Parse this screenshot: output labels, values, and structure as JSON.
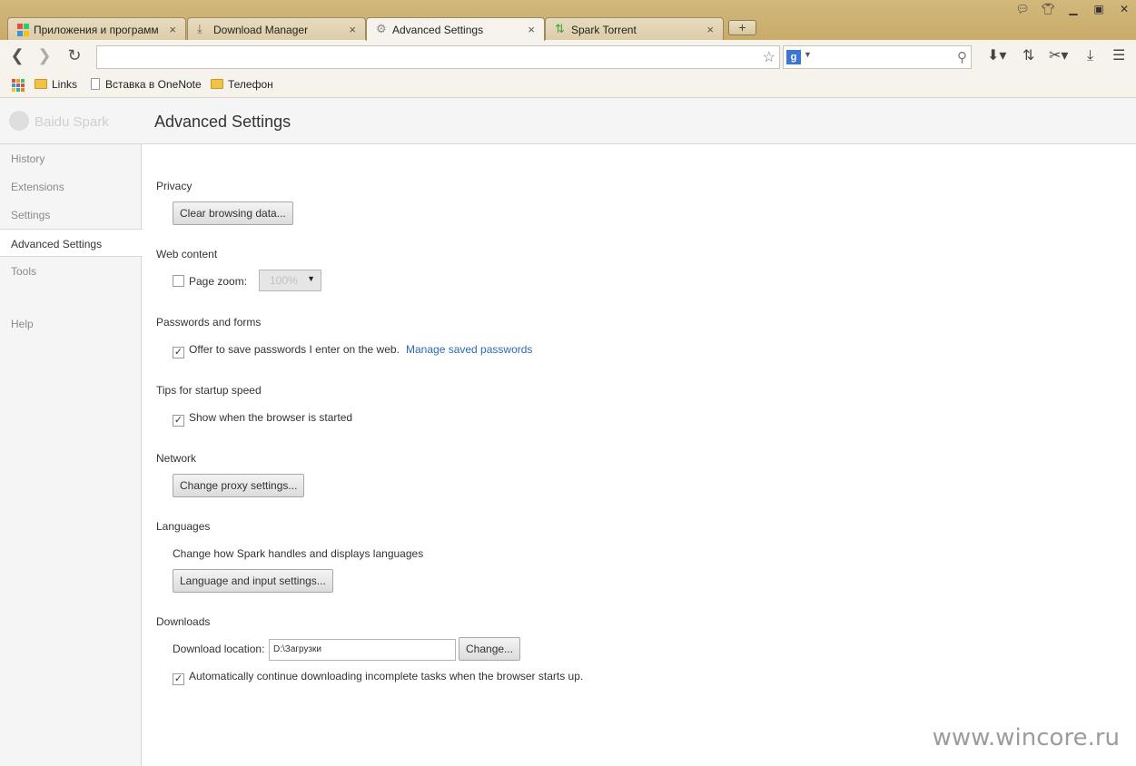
{
  "tabs": [
    {
      "label": "Приложения и программ",
      "icon": "apps-favicon"
    },
    {
      "label": "Download Manager",
      "icon": "download-favicon"
    },
    {
      "label": "Advanced Settings",
      "icon": "gear-favicon",
      "active": true
    },
    {
      "label": "Spark Torrent",
      "icon": "torrent-favicon"
    }
  ],
  "tab_close": "×",
  "new_tab": "+",
  "omnibox": {
    "value": ""
  },
  "search": {
    "engine": "g",
    "value": ""
  },
  "bookmarks": [
    {
      "label": "Links",
      "type": "folder"
    },
    {
      "label": "Вставка в OneNote",
      "type": "page"
    },
    {
      "label": "Телефон",
      "type": "folder"
    }
  ],
  "brand": "Baidu Spark",
  "page_title": "Advanced Settings",
  "sidebar": {
    "items": [
      "History",
      "Extensions",
      "Settings",
      "Advanced Settings",
      "Tools",
      "Help"
    ],
    "active": "Advanced Settings"
  },
  "sections": {
    "privacy": {
      "title": "Privacy",
      "button": "Clear browsing data..."
    },
    "web_content": {
      "title": "Web content",
      "zoom_label": "Page zoom:",
      "zoom_value": "100%",
      "zoom_checked": false
    },
    "passwords": {
      "title": "Passwords and forms",
      "offer_label": "Offer to save passwords I enter on the web.",
      "offer_checked": true,
      "manage_link": "Manage saved passwords"
    },
    "startup": {
      "title": "Tips for startup speed",
      "show_label": "Show when the browser is started",
      "show_checked": true
    },
    "network": {
      "title": "Network",
      "button": "Change proxy settings..."
    },
    "languages": {
      "title": "Languages",
      "description": "Change how Spark handles and displays languages",
      "button": "Language and input settings..."
    },
    "downloads": {
      "title": "Downloads",
      "location_label": "Download location:",
      "location_value": "D:\\Загрузки",
      "change_button": "Change...",
      "auto_label": "Automatically continue downloading incomplete tasks when the browser starts up.",
      "auto_checked": true
    }
  },
  "check_mark": "✓",
  "watermark": "www.wincore.ru"
}
